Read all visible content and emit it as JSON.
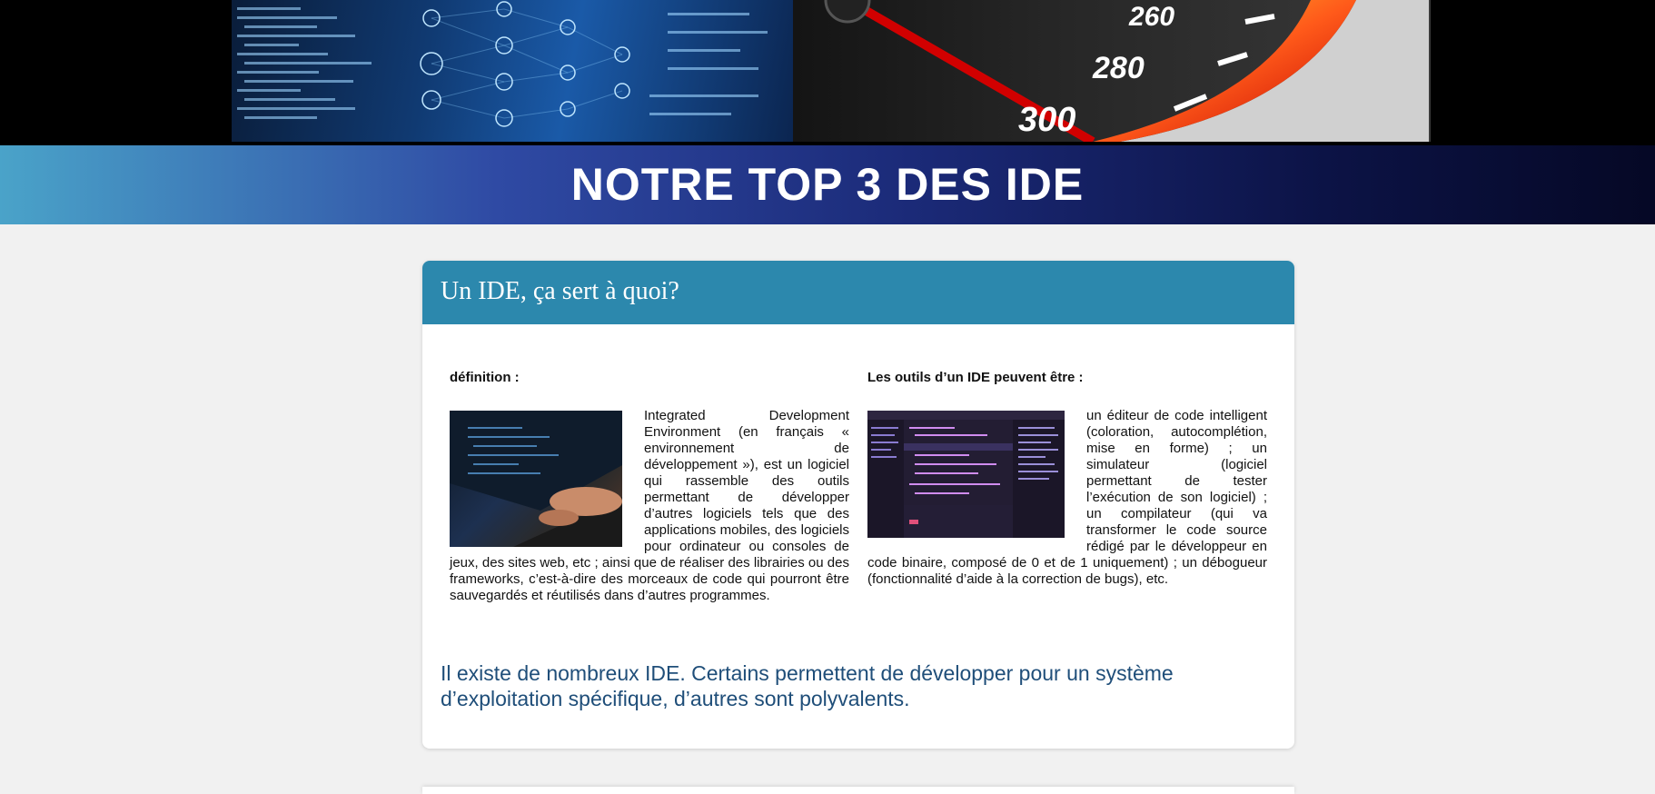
{
  "banner": {
    "speedometer_labels": [
      "260",
      "280",
      "300"
    ]
  },
  "header": {
    "title": "NOTRE TOP 3 DES IDE"
  },
  "card": {
    "title": "Un IDE, ça sert à quoi?",
    "left": {
      "heading": "définition :",
      "text": "Integrated Development Environment (en français « environnement de développement »), est un logiciel qui rassemble des outils permettant de développer d’autres logiciels tels que des applications mobiles, des logiciels pour ordinateur ou consoles de jeux, des sites web, etc ; ainsi que de réaliser des librairies ou des frameworks, c’est-à-dire des morceaux de code qui pourront être sauvegardés et réutilisés dans d’autres programmes.",
      "image_icon": "laptop-photo"
    },
    "right": {
      "heading": "Les outils d’un IDE peuvent être :",
      "text": "un éditeur de code intelligent (coloration, autocomplétion, mise en forme) ; un simulateur (logiciel permettant de tester l’exécution de son logiciel) ; un compilateur (qui va transformer le code source rédigé par le développeur en code binaire, composé de 0 et de 1 uniquement) ; un débogueur (fonctionnalité d’aide à la correction de bugs), etc.",
      "image_icon": "code-editor-screenshot"
    },
    "note": "Il existe de nombreux IDE. Certains permettent de développer pour un système d’exploitation spécifique, d’autres sont polyvalents."
  },
  "colors": {
    "card_header": "#2c88ad",
    "note_text": "#1f4e79",
    "page_background": "#f1f1f1"
  }
}
